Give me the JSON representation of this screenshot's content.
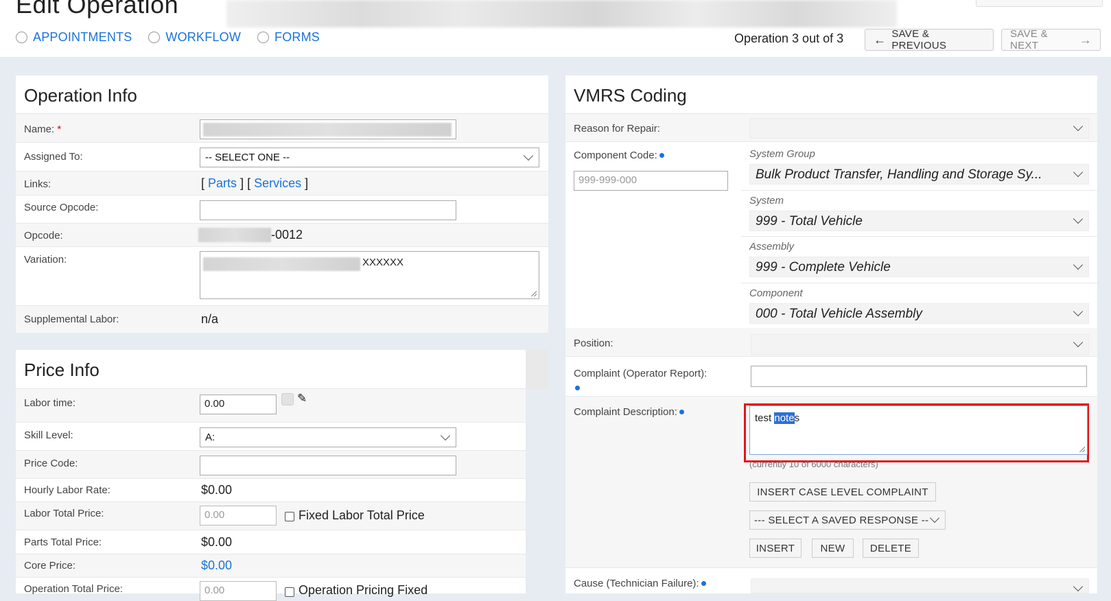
{
  "page": {
    "title": "Edit Operation",
    "tabs": [
      "APPOINTMENTS",
      "WORKFLOW",
      "FORMS"
    ],
    "operation_status": "Operation 3 out of 3",
    "save_prev_label": "SAVE & PREVIOUS",
    "save_next_label": "SAVE & NEXT"
  },
  "operation_info": {
    "title": "Operation Info",
    "name_label": "Name:",
    "required_mark": "*",
    "assigned_label": "Assigned To:",
    "assigned_value": "-- SELECT ONE --",
    "links_label": "Links:",
    "links": {
      "open1": "[",
      "parts": "Parts",
      "close1": "]",
      "open2": "[",
      "services": "Services",
      "close2": "]"
    },
    "source_opcode_label": "Source Opcode:",
    "opcode_label": "Opcode:",
    "opcode_suffix": "-0012",
    "variation_label": "Variation:",
    "variation_suffix": "XXXXXX",
    "supplemental_label": "Supplemental Labor:",
    "supplemental_value": "n/a"
  },
  "price_info": {
    "title": "Price Info",
    "labor_time_label": "Labor time:",
    "labor_time_value": "0.00",
    "skill_label": "Skill Level:",
    "skill_value": "A:",
    "price_code_label": "Price Code:",
    "hourly_label": "Hourly Labor Rate:",
    "hourly_value": "$0.00",
    "labor_total_label": "Labor Total Price:",
    "labor_total_placeholder": "0.00",
    "fixed_labor_label": "Fixed Labor Total Price",
    "parts_total_label": "Parts Total Price:",
    "parts_total_value": "$0.00",
    "core_label": "Core Price:",
    "core_value": "$0.00",
    "op_total_label": "Operation Total Price:",
    "op_total_placeholder": "0.00",
    "op_pricing_fixed_label": "Operation Pricing Fixed"
  },
  "vmrs": {
    "title": "VMRS Coding",
    "reason_label": "Reason for Repair:",
    "component_code_label": "Component Code:",
    "component_code_placeholder": "999-999-000",
    "system_group_caption": "System Group",
    "system_group_value": "Bulk Product Transfer, Handling and Storage Sy...",
    "system_caption": "System",
    "system_value": "999 - Total Vehicle",
    "assembly_caption": "Assembly",
    "assembly_value": "999 - Complete Vehicle",
    "component_caption": "Component",
    "component_value": "000 - Total Vehicle Assembly",
    "position_label": "Position:",
    "complaint_label": "Complaint (Operator Report):",
    "complaint_desc_label": "Complaint Description:",
    "complaint_desc_text": {
      "pre": "test ",
      "selected": "note",
      "post": "s"
    },
    "char_count": "(currently 10 of 6000 characters)",
    "insert_case_label": "INSERT CASE LEVEL COMPLAINT",
    "saved_response_label": "--- SELECT A SAVED RESPONSE --",
    "insert_label": "INSERT",
    "new_label": "NEW",
    "delete_label": "DELETE",
    "cause_label": "Cause (Technician Failure):"
  },
  "colors": {
    "accent": "#1a73d9",
    "highlight_border": "#e0141a",
    "selection": "#2f6fd6"
  }
}
